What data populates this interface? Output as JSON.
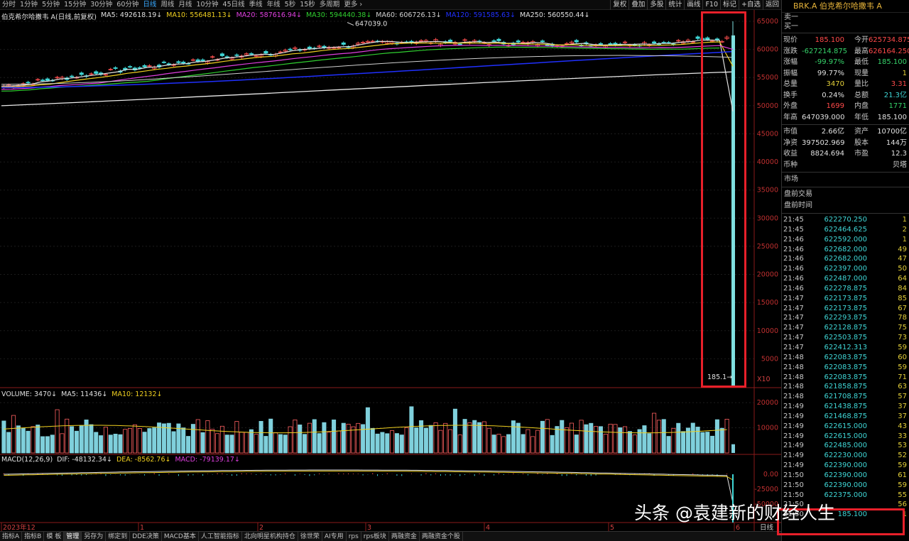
{
  "toolbar": {
    "periods": [
      "分时",
      "1分钟",
      "5分钟",
      "15分钟",
      "30分钟",
      "60分钟",
      "日线",
      "周线",
      "月线",
      "10分钟",
      "45日线",
      "季线",
      "年线",
      "5秒",
      "15秒",
      "多周期",
      "更多 ›"
    ],
    "active_period": "日线",
    "tools": [
      "复权",
      "叠加",
      "多股",
      "统计",
      "画线",
      "F10",
      "标记",
      "+自选",
      "返回"
    ]
  },
  "chart": {
    "title": "伯克希尔哈撒韦 A",
    "subtitle": "(日线,前复权)",
    "ma": [
      {
        "label": "MA5: 492618.19↓",
        "color": "#e0e0e0"
      },
      {
        "label": "MA10: 556481.13↓",
        "color": "#f0d020"
      },
      {
        "label": "MA20: 587616.94↓",
        "color": "#e040e0"
      },
      {
        "label": "MA30: 594440.38↓",
        "color": "#30d030"
      },
      {
        "label": "MA60: 606726.13↓",
        "color": "#d0d0d0"
      },
      {
        "label": "MA120: 591585.63↓",
        "color": "#2030ff"
      },
      {
        "label": "MA250: 560550.44↓",
        "color": "#e0e0e0"
      }
    ],
    "high_label": "647039.0",
    "low_label": "185.1",
    "x10": "X10",
    "y_ticks": [
      "65000",
      "60000",
      "55000",
      "50000",
      "45000",
      "40000",
      "35000",
      "30000",
      "25000",
      "20000",
      "15000",
      "10000",
      "5000"
    ],
    "date_labels": [
      "2023年12",
      "1",
      "2",
      "3",
      "4",
      "5",
      "6"
    ],
    "period_label": "日线"
  },
  "volume": {
    "labels": [
      "VOLUME: 3470↓",
      "MA5: 11436↓",
      "MA10: 12132↓"
    ],
    "y_ticks": [
      "20000",
      "10000"
    ]
  },
  "macd": {
    "labels": [
      "MACD(12,26,9)",
      "DIF: -48132.34↓",
      "DEA: -8562.76↓",
      "MACD: -79139.17↓"
    ],
    "y_ticks": [
      "0.00",
      "-25000",
      "-50000"
    ]
  },
  "bottom_tabs": [
    "指标A",
    "指标B",
    "模 板",
    "管理",
    "另存为",
    "绑定到",
    "DDE决策",
    "MACD基本",
    "人工智能指标",
    "北向明星机构持仓",
    "徐世荣",
    "AI专用",
    "rps",
    "rps板块",
    "两融资金",
    "两融资金个股"
  ],
  "active_bottom_tab": "管理",
  "side": {
    "title": "BRK.A 伯克希尔哈撒韦 A",
    "sell1": "卖一",
    "buy1": "买一",
    "quote": [
      [
        "现价",
        "185.100",
        "red",
        "今开",
        "625734.875",
        "red"
      ],
      [
        "涨跌",
        "-627214.875",
        "green",
        "最高",
        "626164.250",
        "red"
      ],
      [
        "涨幅",
        "-99.97%",
        "green",
        "最低",
        "185.100",
        "green"
      ],
      [
        "振幅",
        "99.77%",
        "white",
        "现量",
        "1",
        "yellow"
      ],
      [
        "总量",
        "3470",
        "yellow",
        "量比",
        "3.31",
        "red"
      ],
      [
        "换手",
        "0.24%",
        "white",
        "总额",
        "21.3亿",
        "cyan"
      ],
      [
        "外盘",
        "1699",
        "red",
        "内盘",
        "1771",
        "green"
      ],
      [
        "年高",
        "647039.000",
        "white",
        "年低",
        "185.100",
        "white"
      ]
    ],
    "fund": [
      [
        "市值",
        "2.66亿",
        "white",
        "资产",
        "10700亿",
        "white"
      ],
      [
        "净资",
        "397502.969",
        "white",
        "股本",
        "144万",
        "white"
      ],
      [
        "收益",
        "8824.694",
        "white",
        "市盈",
        "12.3",
        "white"
      ],
      [
        "币种",
        "",
        "white",
        "",
        "贝塔",
        "white"
      ]
    ],
    "market": "市场",
    "premarket": "盘前交易",
    "premarket_time": "盘前时间",
    "ticks": [
      [
        "21:45",
        "622270.250",
        "1"
      ],
      [
        "21:45",
        "622464.625",
        "2"
      ],
      [
        "21:46",
        "622592.000",
        "1"
      ],
      [
        "21:46",
        "622682.000",
        "49"
      ],
      [
        "21:46",
        "622682.000",
        "47"
      ],
      [
        "21:46",
        "622397.000",
        "50"
      ],
      [
        "21:46",
        "622487.000",
        "64"
      ],
      [
        "21:46",
        "622278.875",
        "84"
      ],
      [
        "21:47",
        "622173.875",
        "85"
      ],
      [
        "21:47",
        "622173.875",
        "67"
      ],
      [
        "21:47",
        "622293.875",
        "78"
      ],
      [
        "21:47",
        "622128.875",
        "75"
      ],
      [
        "21:47",
        "622503.875",
        "73"
      ],
      [
        "21:47",
        "622412.313",
        "59"
      ],
      [
        "21:48",
        "622083.875",
        "60"
      ],
      [
        "21:48",
        "622083.875",
        "59"
      ],
      [
        "21:48",
        "622083.875",
        "71"
      ],
      [
        "21:48",
        "621858.875",
        "63"
      ],
      [
        "21:48",
        "621708.875",
        "57"
      ],
      [
        "21:49",
        "621438.875",
        "37"
      ],
      [
        "21:49",
        "621468.875",
        "37"
      ],
      [
        "21:49",
        "622615.000",
        "43"
      ],
      [
        "21:49",
        "622615.000",
        "33"
      ],
      [
        "21:49",
        "622485.000",
        "53"
      ],
      [
        "21:49",
        "622230.000",
        "52"
      ],
      [
        "21:49",
        "622390.000",
        "59"
      ],
      [
        "21:50",
        "622390.000",
        "61"
      ],
      [
        "21:50",
        "622390.000",
        "59"
      ],
      [
        "21:50",
        "622375.000",
        "55"
      ],
      [
        "21:50",
        "",
        "56"
      ],
      [
        "21:50",
        "185.100",
        "1"
      ]
    ]
  },
  "watermark": "头条 @袁建新的财经人生"
}
